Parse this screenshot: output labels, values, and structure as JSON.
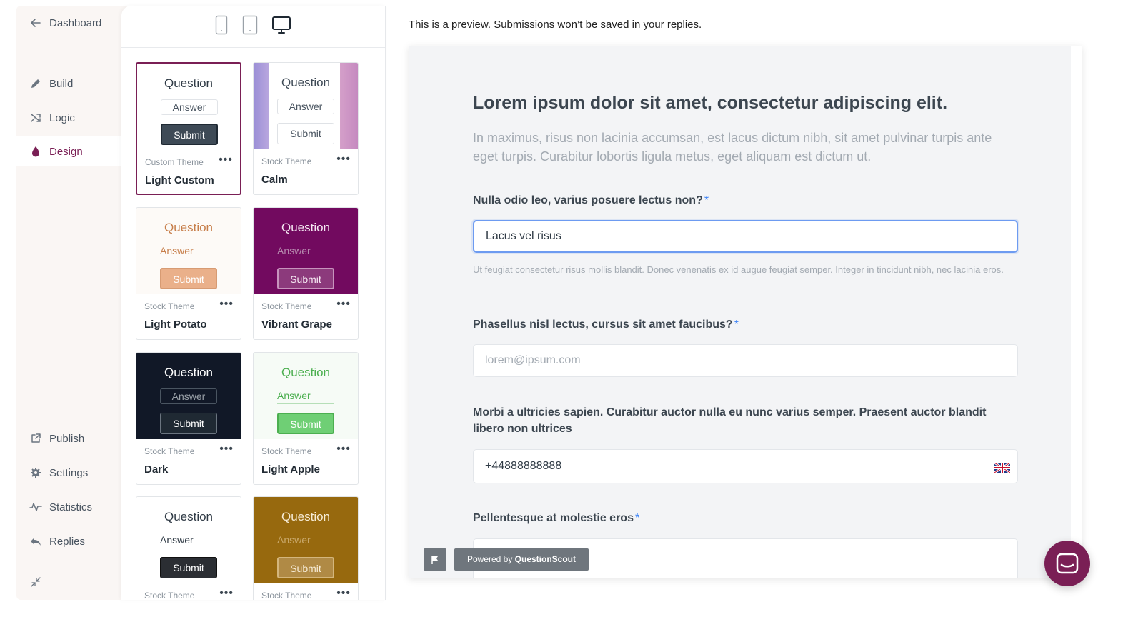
{
  "sidebar": {
    "dashboard": "Dashboard",
    "build": "Build",
    "logic": "Logic",
    "design": "Design",
    "publish": "Publish",
    "settings": "Settings",
    "statistics": "Statistics",
    "replies": "Replies"
  },
  "themes": [
    {
      "question": "Question",
      "answer": "Answer",
      "submit": "Submit",
      "meta": "Custom Theme",
      "name": "Light Custom",
      "dots": "•••"
    },
    {
      "question": "Question",
      "answer": "Answer",
      "submit": "Submit",
      "meta": "Stock Theme",
      "name": "Calm",
      "dots": "•••"
    },
    {
      "question": "Question",
      "answer": "Answer",
      "submit": "Submit",
      "meta": "Stock Theme",
      "name": "Light Potato",
      "dots": "•••"
    },
    {
      "question": "Question",
      "answer": "Answer",
      "submit": "Submit",
      "meta": "Stock Theme",
      "name": "Vibrant Grape",
      "dots": "•••"
    },
    {
      "question": "Question",
      "answer": "Answer",
      "submit": "Submit",
      "meta": "Stock Theme",
      "name": "Dark",
      "dots": "•••"
    },
    {
      "question": "Question",
      "answer": "Answer",
      "submit": "Submit",
      "meta": "Stock Theme",
      "name": "Light Apple",
      "dots": "•••"
    },
    {
      "question": "Question",
      "answer": "Answer",
      "submit": "Submit",
      "meta": "Stock Theme",
      "name": "",
      "dots": "•••"
    },
    {
      "question": "Question",
      "answer": "Answer",
      "submit": "Submit",
      "meta": "Stock Theme",
      "name": "",
      "dots": "•••"
    }
  ],
  "preview": {
    "note": "This is a preview. Submissions won’t be saved in your replies.",
    "title": "Lorem ipsum dolor sit amet, consectetur adipiscing elit.",
    "description": "In maximus, risus non lacinia accumsan, est lacus dictum nibh, sit amet pulvinar turpis ante eget turpis. Curabitur lobortis ligula metus, eget aliquam est dictum ut.",
    "q1_label": "Nulla odio leo, varius posuere lectus non?",
    "q1_value": "Lacus vel risus",
    "q1_hint": "Ut feugiat consectetur risus mollis blandit. Donec venenatis ex id augue feugiat semper. Integer in tincidunt nibh, nec lacinia eros.",
    "q2_label": "Phasellus nisl lectus, cursus sit amet faucibus?",
    "q2_placeholder": "lorem@ipsum.com",
    "q3_label": "Morbi a ultricies sapien. Curabitur auctor nulla eu nunc varius semper. Praesent auctor blandit libero non ultrices",
    "q3_value": "+44888888888",
    "q4_label": "Pellentesque at molestie eros",
    "required_mark": "*",
    "powered_prefix": "Powered by ",
    "powered_brand": "QuestionScout"
  },
  "colors": {
    "accent": "#7a1f55",
    "required": "#3b82f6",
    "focus_border": "#6d9bf1"
  }
}
